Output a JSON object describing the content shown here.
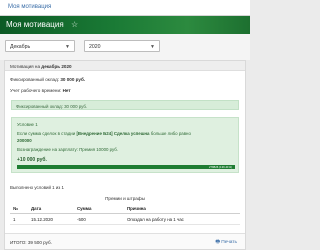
{
  "nav": {
    "link": "Моя мотивация"
  },
  "header": {
    "title": "Моя мотивация",
    "star_icon": "☆"
  },
  "filters": {
    "month": "Декабрь",
    "year": "2020",
    "caret_icon": "▼"
  },
  "panel": {
    "head_prefix": "Мотивация на",
    "head_period": "декабрь 2020",
    "fixed_salary_label": "Фиксированный оклад:",
    "fixed_salary_value": "30 000 руб.",
    "time_tracking_label": "Учет рабочего времени:",
    "time_tracking_value": "Нет",
    "fixed_box_text": "Фиксированный оклад: 30 000 руб.",
    "condition": {
      "title": "Условие 1",
      "line1_prefix": "Если сумма сделок в стадии",
      "line1_stage": "[Внедрение Б24] Сделка успешна",
      "line1_suffix": "больше либо равно",
      "line2": "200000",
      "reward": "Вознаграждение на зарплату: Премия 10000 руб.",
      "bonus": "+10 000 руб.",
      "progress_label": "278826 (139.41%)",
      "progress_fraction": 1.0
    },
    "conditions_done": "Выполнено условий 1 из 1",
    "section_title": "Премии и штрафы",
    "table": {
      "headers": [
        "№",
        "Дата",
        "Сумма",
        "Причина"
      ],
      "rows": [
        [
          "1",
          "15.12.2020",
          "-500",
          "Опоздал на работу на 1 час"
        ]
      ]
    },
    "footer": {
      "total": "ИТОГО: 39 500 руб.",
      "print_icon": "🖶",
      "print_label": "Печать"
    }
  }
}
